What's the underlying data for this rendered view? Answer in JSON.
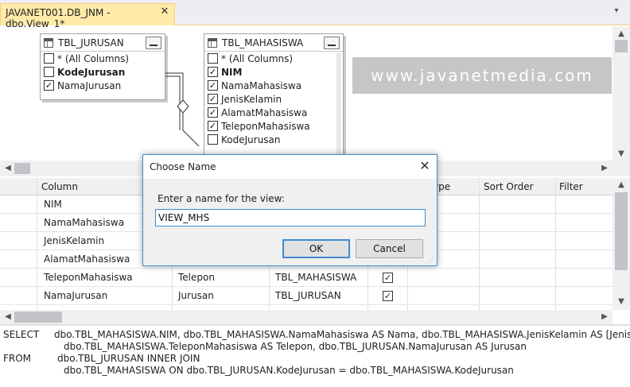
{
  "tab": {
    "title": "JAVANET001.DB_JNM - dbo.View_1*",
    "close_glyph": "✕",
    "dropdown_glyph": "▾"
  },
  "diagram": {
    "tables": [
      {
        "name": "TBL_JURUSAN",
        "columns": [
          {
            "label": "* (All Columns)",
            "checked": false,
            "bold": false
          },
          {
            "label": "KodeJurusan",
            "checked": false,
            "bold": true
          },
          {
            "label": "NamaJurusan",
            "checked": true,
            "bold": false
          }
        ]
      },
      {
        "name": "TBL_MAHASISWA",
        "columns": [
          {
            "label": "* (All Columns)",
            "checked": false,
            "bold": false
          },
          {
            "label": "NIM",
            "checked": true,
            "bold": true
          },
          {
            "label": "NamaMahasiswa",
            "checked": true,
            "bold": false
          },
          {
            "label": "JenisKelamin",
            "checked": true,
            "bold": false
          },
          {
            "label": "AlamatMahasiswa",
            "checked": true,
            "bold": false
          },
          {
            "label": "TeleponMahasiswa",
            "checked": true,
            "bold": false
          },
          {
            "label": "KodeJurusan",
            "checked": false,
            "bold": false
          }
        ]
      }
    ],
    "watermark": "www.javanetmedia.com"
  },
  "grid": {
    "headers": {
      "column": "Column",
      "type_partial": "ype",
      "sort_order": "Sort Order",
      "filter": "Filter"
    },
    "rows": [
      {
        "column": "NIM",
        "alias": "",
        "table": "",
        "output": false
      },
      {
        "column": "NamaMahasiswa",
        "alias": "",
        "table": "",
        "output": false
      },
      {
        "column": "JenisKelamin",
        "alias": "",
        "table": "",
        "output": false
      },
      {
        "column": "AlamatMahasiswa",
        "alias": "",
        "table": "",
        "output": false
      },
      {
        "column": "TeleponMahasiswa",
        "alias": "Telepon",
        "table": "TBL_MAHASISWA",
        "output": true
      },
      {
        "column": "NamaJurusan",
        "alias": "Jurusan",
        "table": "TBL_JURUSAN",
        "output": true
      }
    ]
  },
  "sql": {
    "lines": [
      {
        "keyword": "SELECT",
        "text": "dbo.TBL_MAHASISWA.NIM, dbo.TBL_MAHASISWA.NamaMahasiswa AS Nama, dbo.TBL_MAHASISWA.JenisKelamin AS [Jenis Kelamin], d"
      },
      {
        "keyword": "",
        "text": "dbo.TBL_MAHASISWA.TeleponMahasiswa AS Telepon, dbo.TBL_JURUSAN.NamaJurusan AS Jurusan"
      },
      {
        "keyword": "FROM",
        "text": "dbo.TBL_JURUSAN INNER JOIN"
      },
      {
        "keyword": "",
        "text": "dbo.TBL_MAHASISWA ON dbo.TBL_JURUSAN.KodeJurusan = dbo.TBL_MAHASISWA.KodeJurusan"
      }
    ]
  },
  "dialog": {
    "title": "Choose Name",
    "close_glyph": "✕",
    "prompt": "Enter a name for the view:",
    "input_value": "VIEW_MHS",
    "ok_label": "OK",
    "cancel_label": "Cancel"
  },
  "colors": {
    "accent": "#3f8ad0",
    "tab_active": "#ffeaa8",
    "watermark_bg": "#c5c6c8"
  }
}
